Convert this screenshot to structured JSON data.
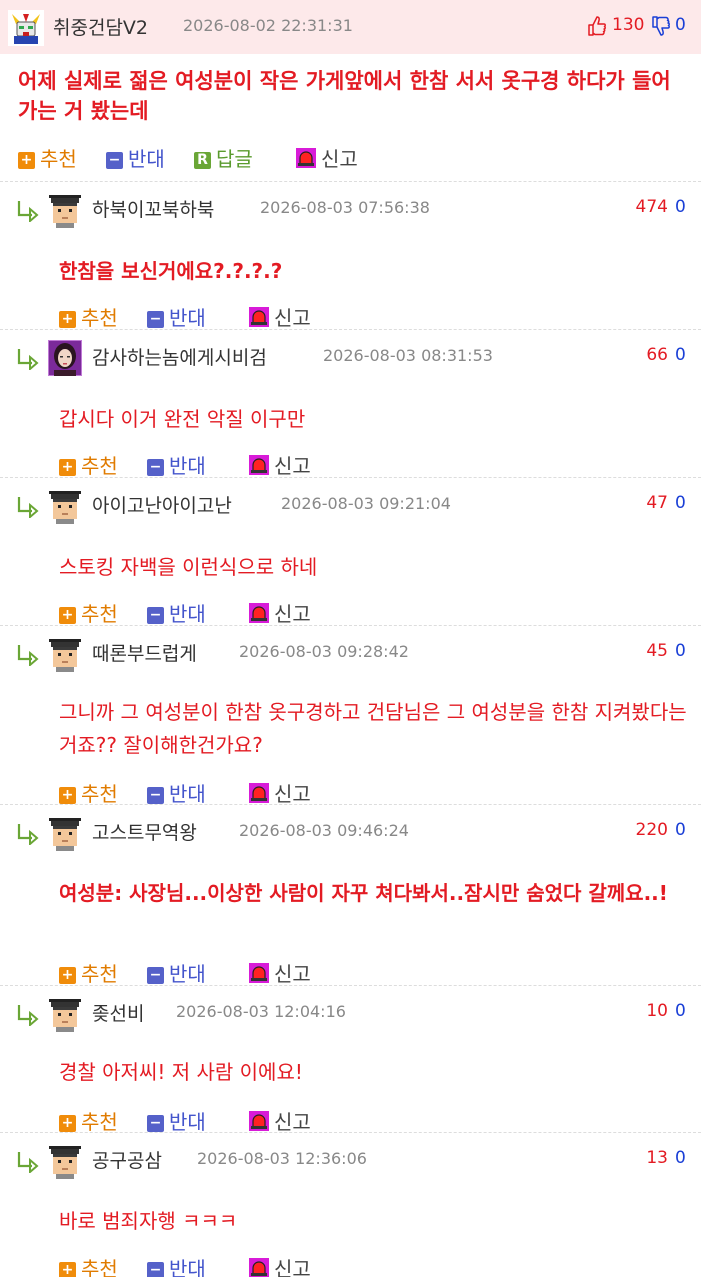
{
  "post": {
    "author": "취중건담V2",
    "avatar_icon": "gundam-avatar",
    "datetime": "2026-08-02 22:31:31",
    "upvotes": "130",
    "downvotes": "0",
    "content": "어제 실제로 젊은 여성분이 작은 가게앞에서 한참 서서 옷구경 하다가 들어가는 거 봤는데",
    "actions": {
      "recommend": "추천",
      "oppose": "반대",
      "reply": "답글",
      "report": "신고"
    }
  },
  "comments": [
    {
      "author": "하북이꼬북하북",
      "avatar_icon": "pixel-avatar",
      "datetime": "2026-08-03 07:56:38",
      "upvotes": "474",
      "downvotes": "0",
      "content": "한참을 보신거에요?.?.?.?",
      "bold": true
    },
    {
      "author": "감사하는놈에게시비검",
      "avatar_icon": "photo-avatar",
      "datetime": "2026-08-03 08:31:53",
      "upvotes": "66",
      "downvotes": "0",
      "content": "갑시다 이거 완전 악질 이구만",
      "bold": false
    },
    {
      "author": "아이고난아이고난",
      "avatar_icon": "pixel-avatar",
      "datetime": "2026-08-03 09:21:04",
      "upvotes": "47",
      "downvotes": "0",
      "content": "스토킹 자백을 이런식으로 하네",
      "bold": false
    },
    {
      "author": "때론부드럽게",
      "avatar_icon": "pixel-avatar",
      "datetime": "2026-08-03 09:28:42",
      "upvotes": "45",
      "downvotes": "0",
      "content": "그니까 그 여성분이 한참 옷구경하고 건담님은 그 여성분을 한참 지켜봤다는거죠?? 잘이해한건가요?",
      "bold": false
    },
    {
      "author": "고스트무역왕",
      "avatar_icon": "pixel-avatar",
      "datetime": "2026-08-03 09:46:24",
      "upvotes": "220",
      "downvotes": "0",
      "content": "여성분: 사장님...이상한 사람이 자꾸 쳐다봐서..잠시만 숨었다 갈께요..!",
      "bold": true
    },
    {
      "author": "좆선비",
      "avatar_icon": "pixel-avatar",
      "datetime": "2026-08-03 12:04:16",
      "upvotes": "10",
      "downvotes": "0",
      "content": "경찰 아저씨! 저 사람 이에요!",
      "bold": false
    },
    {
      "author": "공구공삼",
      "avatar_icon": "pixel-avatar",
      "datetime": "2026-08-03 12:36:06",
      "upvotes": "13",
      "downvotes": "0",
      "content": "바로 범죄자행 ㅋㅋㅋ",
      "bold": false
    }
  ],
  "comment_actions": {
    "recommend": "추천",
    "oppose": "반대",
    "report": "신고"
  },
  "colors": {
    "header_bg": "#fde9ea",
    "content_red": "#e31b23",
    "down_blue": "#1a3fd6",
    "recommend_orange": "#f08c0a",
    "oppose_blue": "#5561c9",
    "reply_green": "#6aa636"
  }
}
